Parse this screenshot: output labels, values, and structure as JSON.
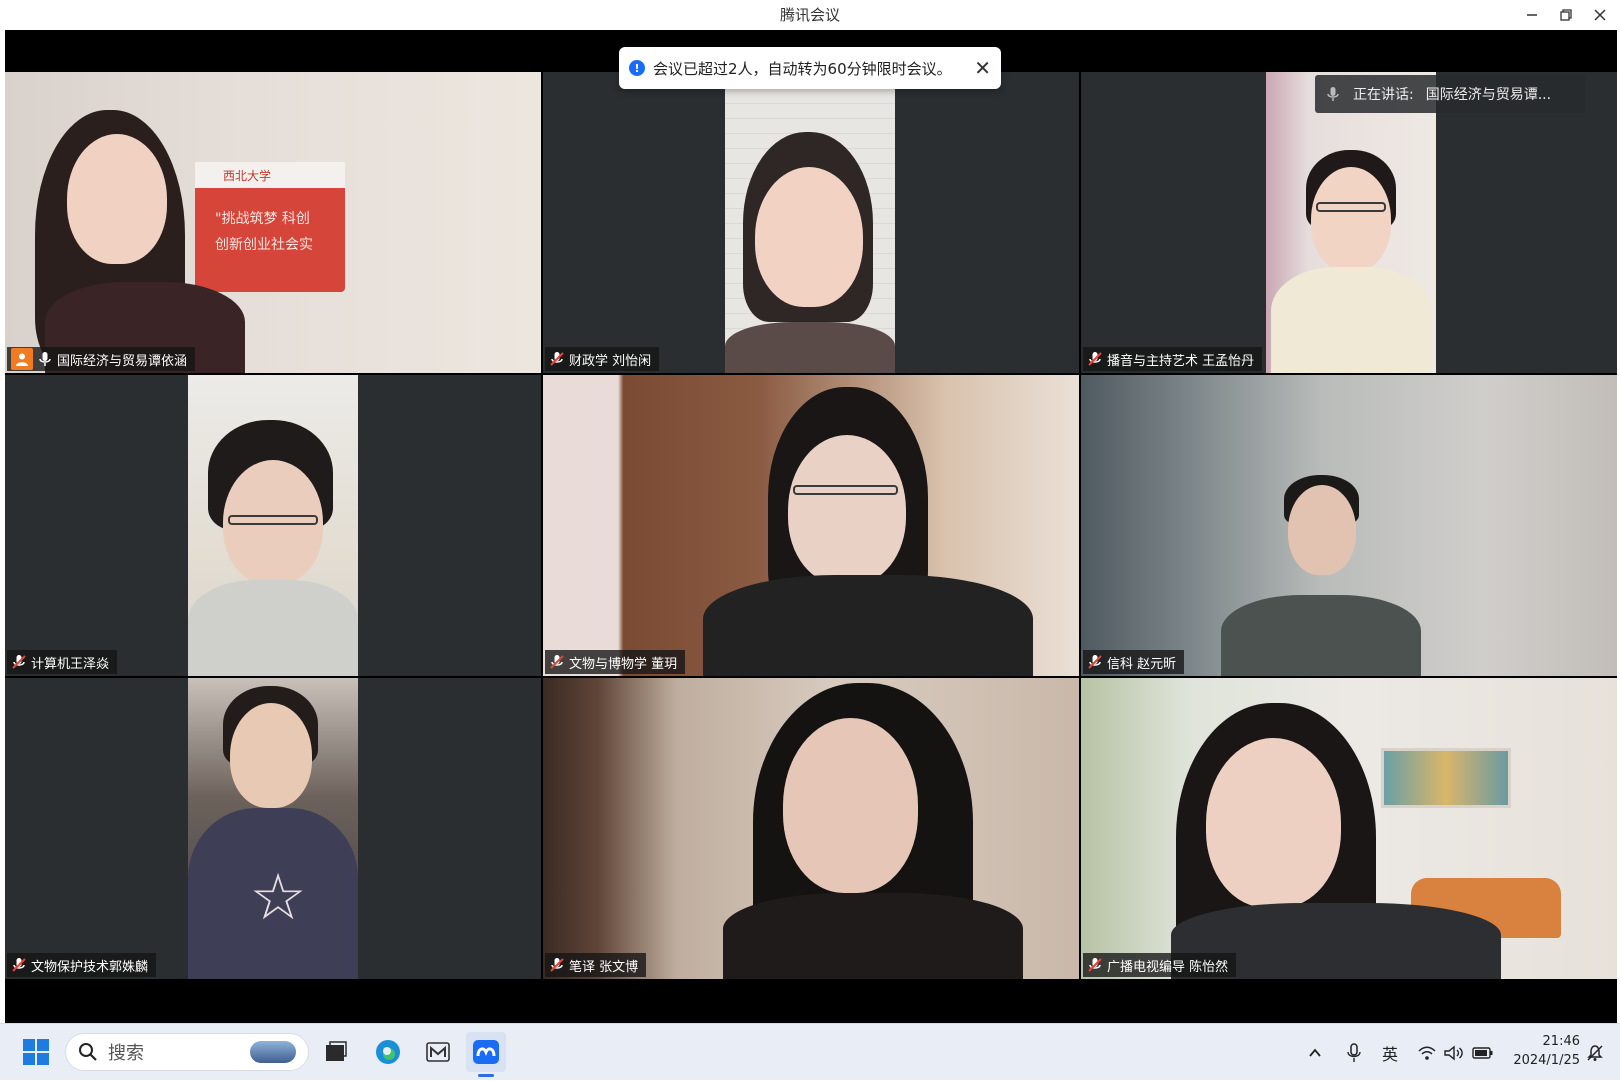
{
  "window": {
    "title": "腾讯会议"
  },
  "notification": {
    "text": "会议已超过2人，自动转为60分钟限时会议。",
    "close": "✕"
  },
  "speaking": {
    "label": "正在讲话:",
    "name": "国际经济与贸易谭..."
  },
  "participants": [
    {
      "name": "国际经济与贸易谭依涵",
      "active_speaker": true
    },
    {
      "name": "财政学 刘怡闲"
    },
    {
      "name": "播音与主持艺术 王孟怡丹"
    },
    {
      "name": "计算机王泽焱"
    },
    {
      "name": "文物与博物学 董玥"
    },
    {
      "name": "信科 赵元昕"
    },
    {
      "name": "文物保护技术郭姝麟"
    },
    {
      "name": "笔译 张文博"
    },
    {
      "name": "广播电视编导 陈怡然"
    }
  ],
  "video_texts": {
    "banner_line1": "\"挑战筑梦 科创",
    "banner_line2": "创新创业社会实",
    "banner_school": "西北大学"
  },
  "taskbar": {
    "search_placeholder": "搜索",
    "ime": "英",
    "time": "21:46",
    "date": "2024/1/25",
    "tray_chevron": "^"
  },
  "colors": {
    "active_border": "#2ecc71",
    "info_blue": "#1a6df2",
    "muted_red": "#e0463a"
  }
}
